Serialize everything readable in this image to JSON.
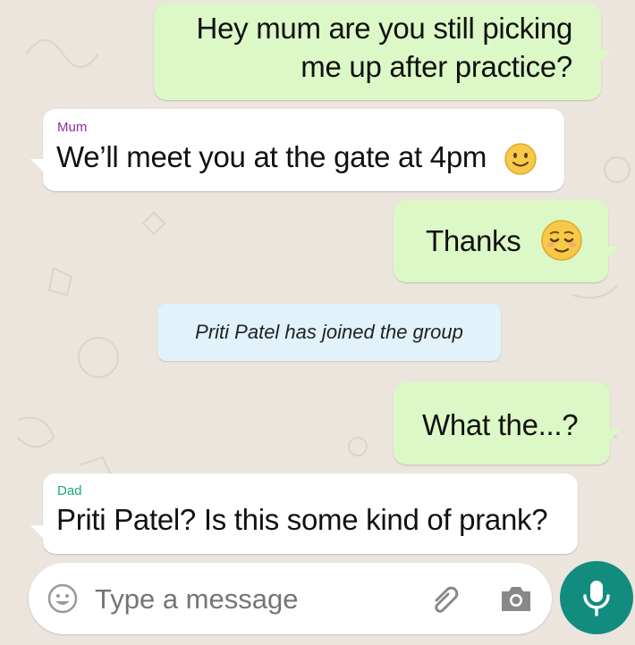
{
  "colors": {
    "outgoing_bubble": "#dcf8c6",
    "incoming_bubble": "#ffffff",
    "system_bubble": "#e1f2fb",
    "mum_name": "#8e2c9a",
    "dad_name": "#1fa67a",
    "send_button": "#128c7e"
  },
  "messages": [
    {
      "direction": "outgoing",
      "lines": [
        "Hey mum are you still picking",
        "me up after practice?"
      ]
    },
    {
      "direction": "incoming",
      "sender": "Mum",
      "text": "We’ll meet you at the gate at 4pm",
      "emoji": "slightly-smiling-face"
    },
    {
      "direction": "outgoing",
      "text": "Thanks",
      "emoji": "relieved-face"
    },
    {
      "direction": "system",
      "text": "Priti Patel has joined the group"
    },
    {
      "direction": "outgoing",
      "text": "What the...?"
    },
    {
      "direction": "incoming",
      "sender": "Dad",
      "text": "Priti Patel? Is this some kind of prank?"
    }
  ],
  "composer": {
    "placeholder": "Type a message",
    "icons": [
      "emoji-icon",
      "attachment-icon",
      "camera-icon"
    ],
    "send_icon": "microphone-icon"
  }
}
